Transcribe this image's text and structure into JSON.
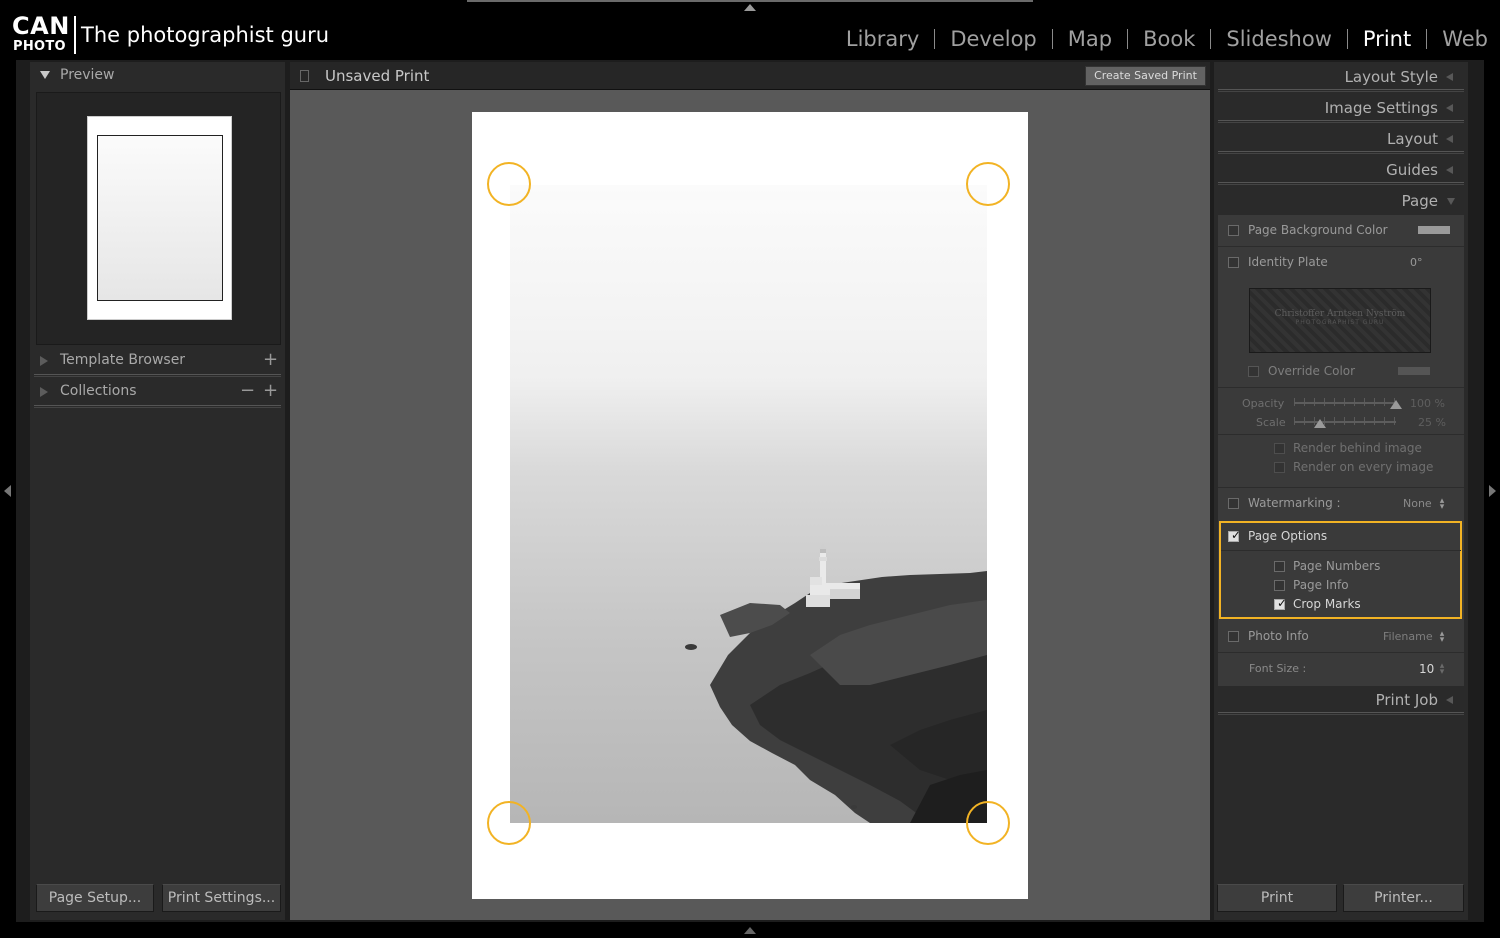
{
  "branding": {
    "logo_top": "CAN",
    "logo_bottom": "PHOTO",
    "tagline": "The photographist guru"
  },
  "modules": [
    {
      "label": "Library",
      "active": false
    },
    {
      "label": "Develop",
      "active": false
    },
    {
      "label": "Map",
      "active": false
    },
    {
      "label": "Book",
      "active": false
    },
    {
      "label": "Slideshow",
      "active": false
    },
    {
      "label": "Print",
      "active": true
    },
    {
      "label": "Web",
      "active": false
    }
  ],
  "left_panel": {
    "preview_label": "Preview",
    "template_browser_label": "Template Browser",
    "template_browser_add": "+",
    "collections_label": "Collections",
    "collections_remove": "−",
    "collections_add": "+",
    "page_setup_label": "Page Setup...",
    "print_settings_label": "Print Settings..."
  },
  "center": {
    "title": "Unsaved Print",
    "create_saved_label": "Create Saved Print"
  },
  "right_panel": {
    "sections": {
      "layout_style": "Layout Style",
      "image_settings": "Image Settings",
      "layout": "Layout",
      "guides": "Guides",
      "page": "Page",
      "print_job": "Print Job"
    },
    "page": {
      "page_background_color": {
        "label": "Page Background Color",
        "checked": false,
        "swatch": "#9a9a9a"
      },
      "identity_plate": {
        "label": "Identity Plate",
        "checked": false,
        "angle": "0°",
        "plate_name": "Christoffer Arntsen Nyström",
        "plate_sub": "PHOTOGRAPHIST GURU",
        "override_color_label": "Override Color",
        "override_checked": false,
        "override_swatch": "#555555"
      },
      "opacity": {
        "label": "Opacity",
        "value": "100 %",
        "level": 1.0
      },
      "scale": {
        "label": "Scale",
        "value": "25 %",
        "level": 0.25
      },
      "render_behind_label": "Render behind image",
      "render_every_label": "Render on every image",
      "watermarking": {
        "label": "Watermarking :",
        "value": "None",
        "checked": false
      },
      "page_options": {
        "label": "Page Options",
        "checked": true,
        "page_numbers": {
          "label": "Page Numbers",
          "checked": false
        },
        "page_info": {
          "label": "Page Info",
          "checked": false
        },
        "crop_marks": {
          "label": "Crop Marks",
          "checked": true
        }
      },
      "photo_info": {
        "label": "Photo Info",
        "value": "Filename",
        "checked": false
      },
      "font_size": {
        "label": "Font Size :",
        "value": "10"
      }
    },
    "print_label": "Print",
    "printer_label": "Printer..."
  },
  "colors": {
    "highlight": "#f2b324",
    "panel_bg": "#2a2a2a",
    "canvas_bg": "#595959"
  }
}
